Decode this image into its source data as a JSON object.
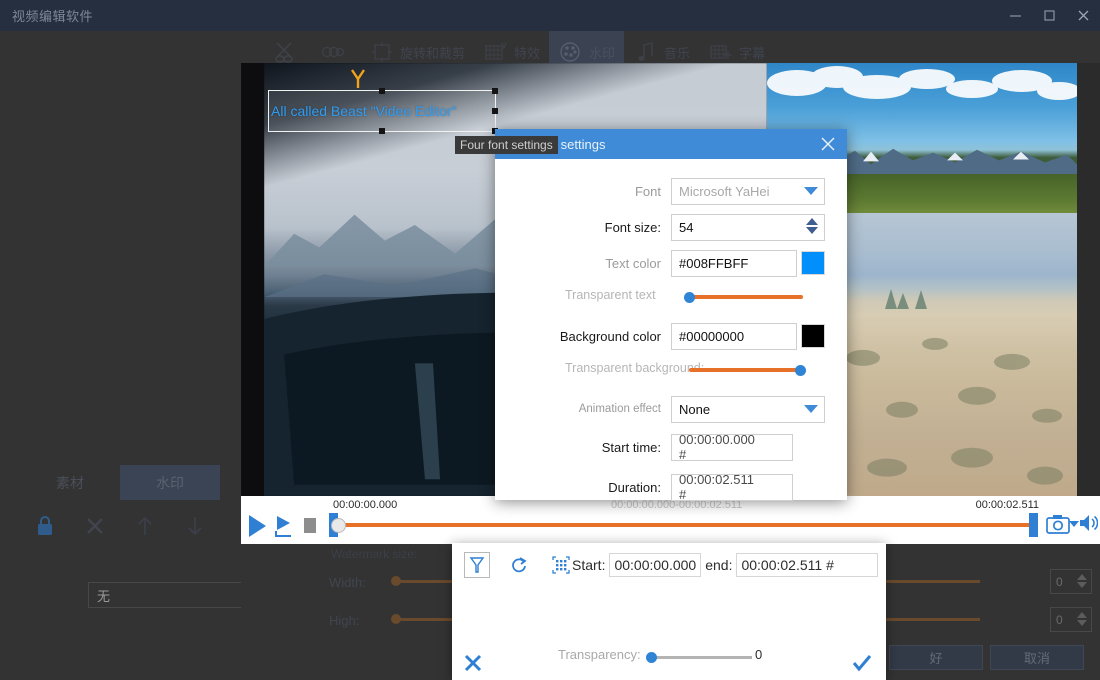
{
  "window": {
    "title": "视频编辑软件",
    "minimize_icon": "minimize-icon",
    "maximize_icon": "maximize-icon",
    "close_icon": "close-icon"
  },
  "toolbar": {
    "items": [
      {
        "label": "",
        "icon": "scissors-icon",
        "active": false
      },
      {
        "label": "",
        "icon": "film-strip-icon",
        "active": false
      },
      {
        "label": "旋转和裁剪",
        "icon": "crop-rotate-icon",
        "active": false
      },
      {
        "label": "特效",
        "icon": "effects-icon",
        "active": false
      },
      {
        "label": "水印",
        "icon": "watermark-reel-icon",
        "active": true
      },
      {
        "label": "音乐",
        "icon": "music-note-icon",
        "active": false
      },
      {
        "label": "字幕",
        "icon": "subtitle-icon",
        "active": false
      }
    ]
  },
  "preview": {
    "overlay_text": "All called Beast \"Video Editor\"",
    "overlay_text_color": "#2f9cf2"
  },
  "dialog": {
    "tag_label": "Four font settings",
    "title": "Four font settings",
    "close_icon": "close-icon",
    "fields": {
      "font_label": "Font",
      "font_value": "Microsoft YaHei",
      "font_size_label": "Font size:",
      "font_size_value": "54",
      "text_color_label": "Text color",
      "text_color_value": "#008FFBFF",
      "text_color_swatch": "#008FFB",
      "transparent_text_label": "Transparent text",
      "transparent_text_value": 0,
      "background_color_label": "Background color",
      "background_color_value": "#00000000",
      "background_color_swatch": "#000000",
      "transparent_background_label": "Transparent background:",
      "transparent_background_value": 100,
      "animation_effect_label": "Animation effect",
      "animation_effect_value": "None",
      "start_time_label": "Start time:",
      "start_time_value": "00:00:00.000 #",
      "duration_label": "Duration:",
      "duration_value": "00:00:02.511 #"
    }
  },
  "timeline": {
    "current_time": "00:00:00.000",
    "range_text": "00:00:00.000-00:00:02.511",
    "total_time": "00:00:02.511",
    "play_icon": "play-icon",
    "play_segment_icon": "play-segment-icon",
    "stop_icon": "stop-icon",
    "snapshot_icon": "camera-icon",
    "volume_icon": "speaker-icon",
    "dropdown_icon": "chevron-down-icon"
  },
  "left_panel": {
    "tabs": [
      {
        "label": "素材",
        "active": false
      },
      {
        "label": "水印",
        "active": true
      }
    ],
    "icons": [
      "lock-icon",
      "delete-x-icon",
      "move-up-icon",
      "move-down-icon"
    ],
    "select_value": "无"
  },
  "watermark_size": {
    "title": "Watermark size:",
    "rows": [
      {
        "label": "Width:",
        "value": "0"
      },
      {
        "label": "High:",
        "value": "0"
      }
    ]
  },
  "footer": {
    "ok_label": "好",
    "cancel_label": "取消"
  },
  "popup": {
    "tools": [
      "funnel-icon",
      "rotate-icon",
      "grid-select-icon"
    ],
    "start_label": "Start:",
    "start_value": "00:00:00.000",
    "end_label": "end:",
    "end_value": "00:00:02.511 #",
    "transparency_label": "Transparency:",
    "transparency_value": "0",
    "cancel_icon": "x-icon",
    "confirm_icon": "check-icon"
  },
  "colors": {
    "accent_blue": "#3f8bd8",
    "slider_orange": "#e8712a",
    "knob_blue": "#2f84d6",
    "chrome_dark": "#333333",
    "titlebar": "#252f3f"
  }
}
